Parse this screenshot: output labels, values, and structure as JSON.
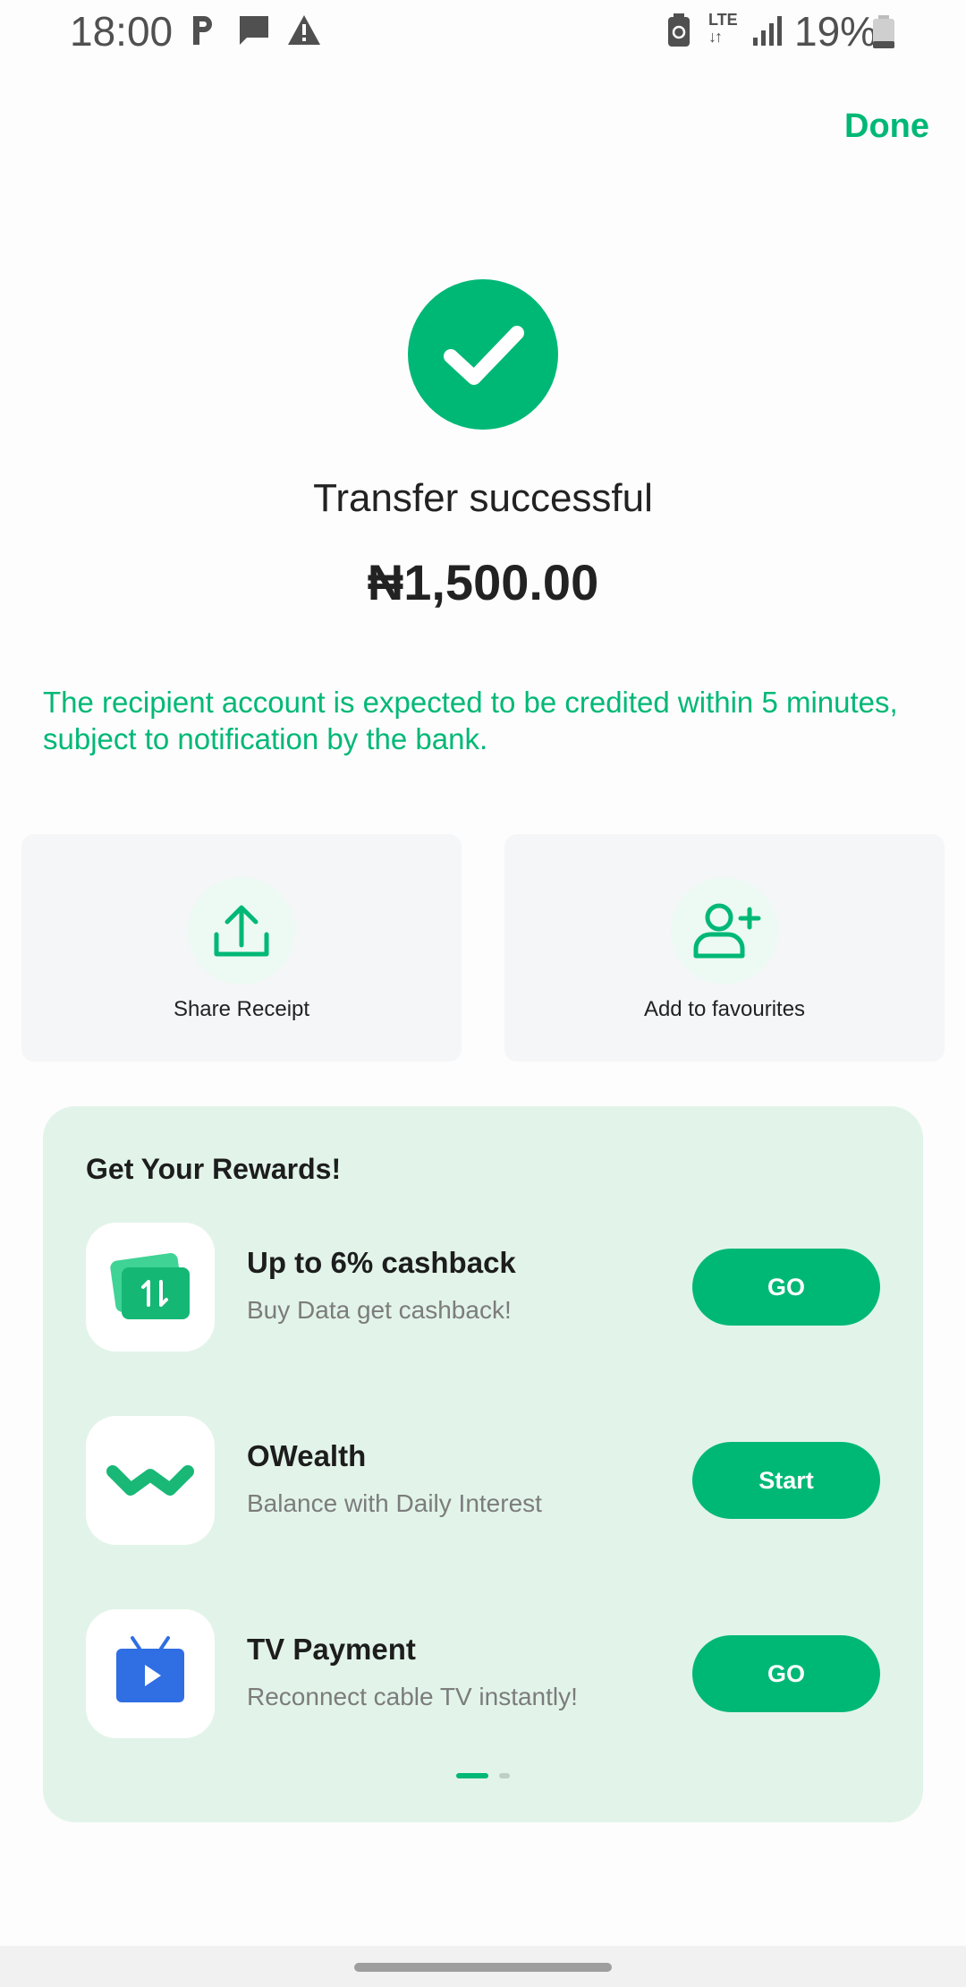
{
  "status_bar": {
    "time": "18:00",
    "network": "LTE",
    "battery": "19%",
    "icons": [
      "parking-icon",
      "message-icon",
      "warning-icon",
      "battery-saver-icon",
      "lte-icon",
      "signal-icon",
      "battery-icon"
    ]
  },
  "header": {
    "done_label": "Done"
  },
  "success": {
    "title": "Transfer successful",
    "amount": "₦1,500.00",
    "note": "The recipient account is expected to be credited within 5 minutes, subject to notification by the bank."
  },
  "actions": [
    {
      "label": "Share Receipt",
      "icon": "upload-icon"
    },
    {
      "label": "Add to favourites",
      "icon": "add-user-icon"
    }
  ],
  "rewards": {
    "title": "Get Your Rewards!",
    "items": [
      {
        "title": "Up to 6% cashback",
        "subtitle": "Buy Data get cashback!",
        "button": "GO",
        "icon": "data-card-icon"
      },
      {
        "title": "OWealth",
        "subtitle": "Balance with Daily Interest",
        "button": "Start",
        "icon": "owealth-logo-icon"
      },
      {
        "title": "TV Payment",
        "subtitle": "Reconnect cable TV instantly!",
        "button": "GO",
        "icon": "tv-icon"
      }
    ],
    "page_count": 2,
    "active_page": 1
  },
  "colors": {
    "accent": "#00b876",
    "panel": "#e2f4e9",
    "card": "#f5f6f8"
  }
}
